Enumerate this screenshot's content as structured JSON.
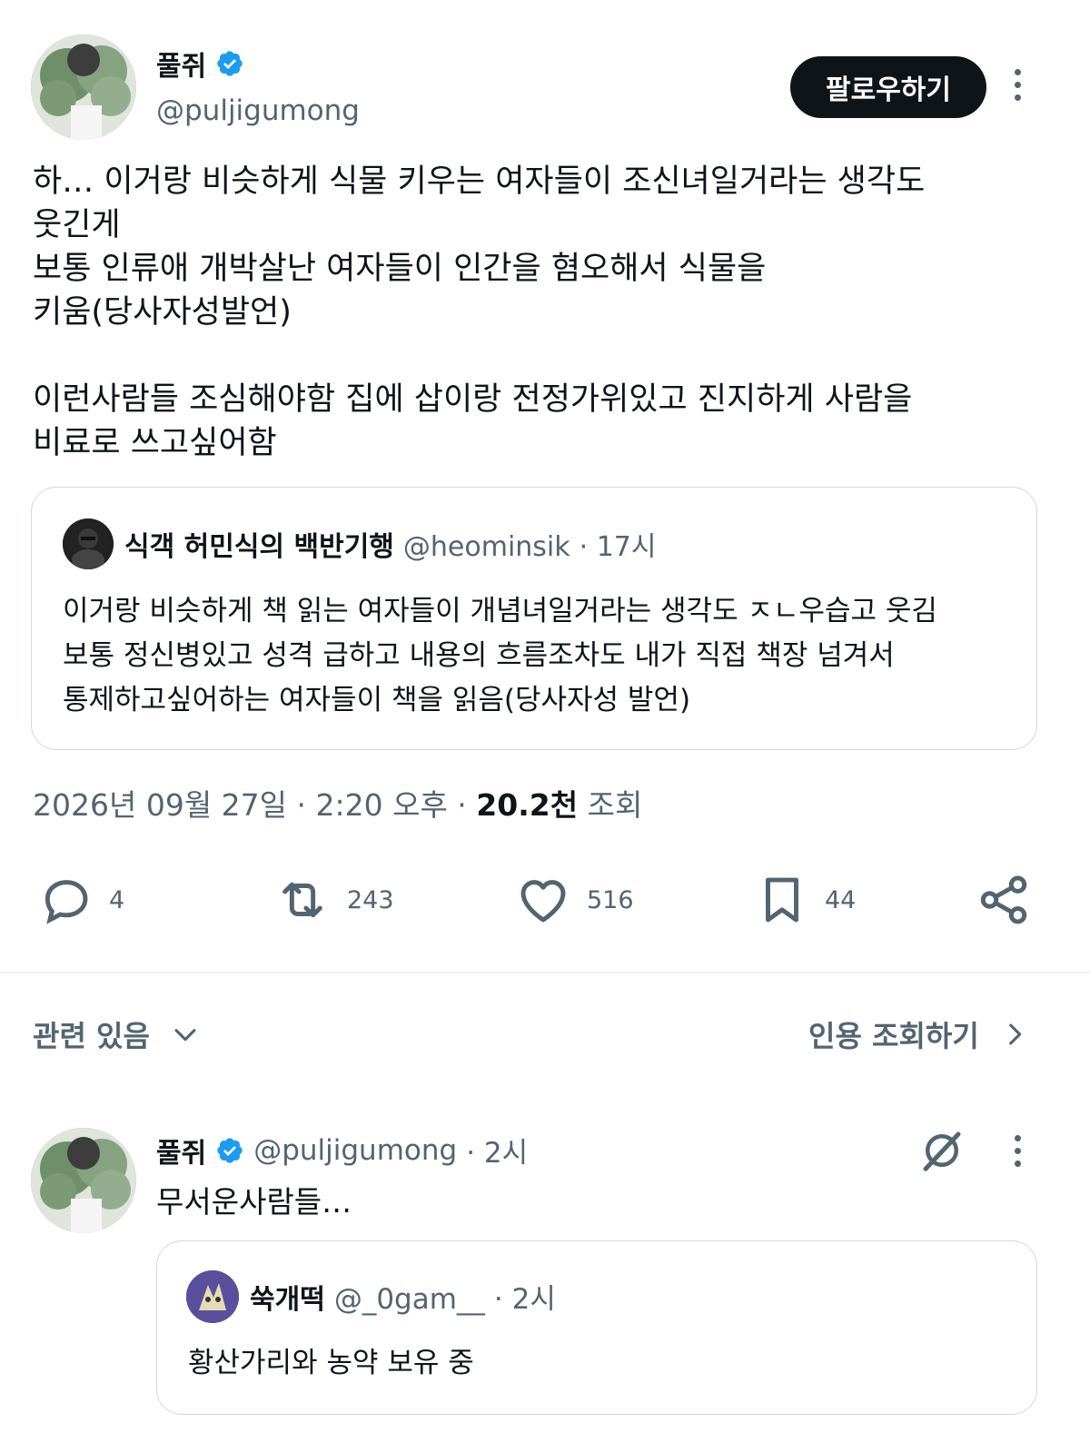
{
  "tweet": {
    "author_name": "풀쥐",
    "author_handle": "@puljigumong",
    "follow_label": "팔로우하기",
    "text": "하… 이거랑 비슷하게 식물 키우는 여자들이 조신녀일거라는 생각도\n웃긴게\n보통 인류애 개박살난 여자들이 인간을 혐오해서 식물을\n키움(당사자성발언)\n\n이런사람들 조심해야함 집에 삽이랑 전정가위있고 진지하게 사람을\n비료로 쓰고싶어함",
    "quote": {
      "author_name": "식객 허민식의 백반기행",
      "author_handle": "@heominsik",
      "time": "· 17시",
      "text": "이거랑 비슷하게 책 읽는 여자들이 개념녀일거라는 생각도 ㅈㄴ우습고 웃김\n보통 정신병있고 성격 급하고 내용의 흐름조차도 내가 직접 책장 넘겨서\n통제하고싶어하는 여자들이 책을 읽음(당사자성 발언)"
    },
    "meta": {
      "date": "2026년 09월 27일 · 2:20 오후 ·",
      "views_count": "20.2천",
      "views_label": "조회"
    },
    "actions": {
      "reply_count": "4",
      "retweet_count": "243",
      "like_count": "516",
      "bookmark_count": "44"
    }
  },
  "related": {
    "left_label": "관련 있음",
    "right_label": "인용 조회하기"
  },
  "reply": {
    "author_name": "풀쥐",
    "author_handle": "@puljigumong",
    "time": "· 2시",
    "text": "무서운사람들…",
    "quote": {
      "author_name": "쑥개떡",
      "author_handle": "@_0gam__",
      "time": "· 2시",
      "text": "황산가리와 농약 보유 중"
    }
  },
  "colors": {
    "verified": "#1d9bf0",
    "text": "#0f1419",
    "secondary": "#536471",
    "border": "#cfd9de"
  }
}
